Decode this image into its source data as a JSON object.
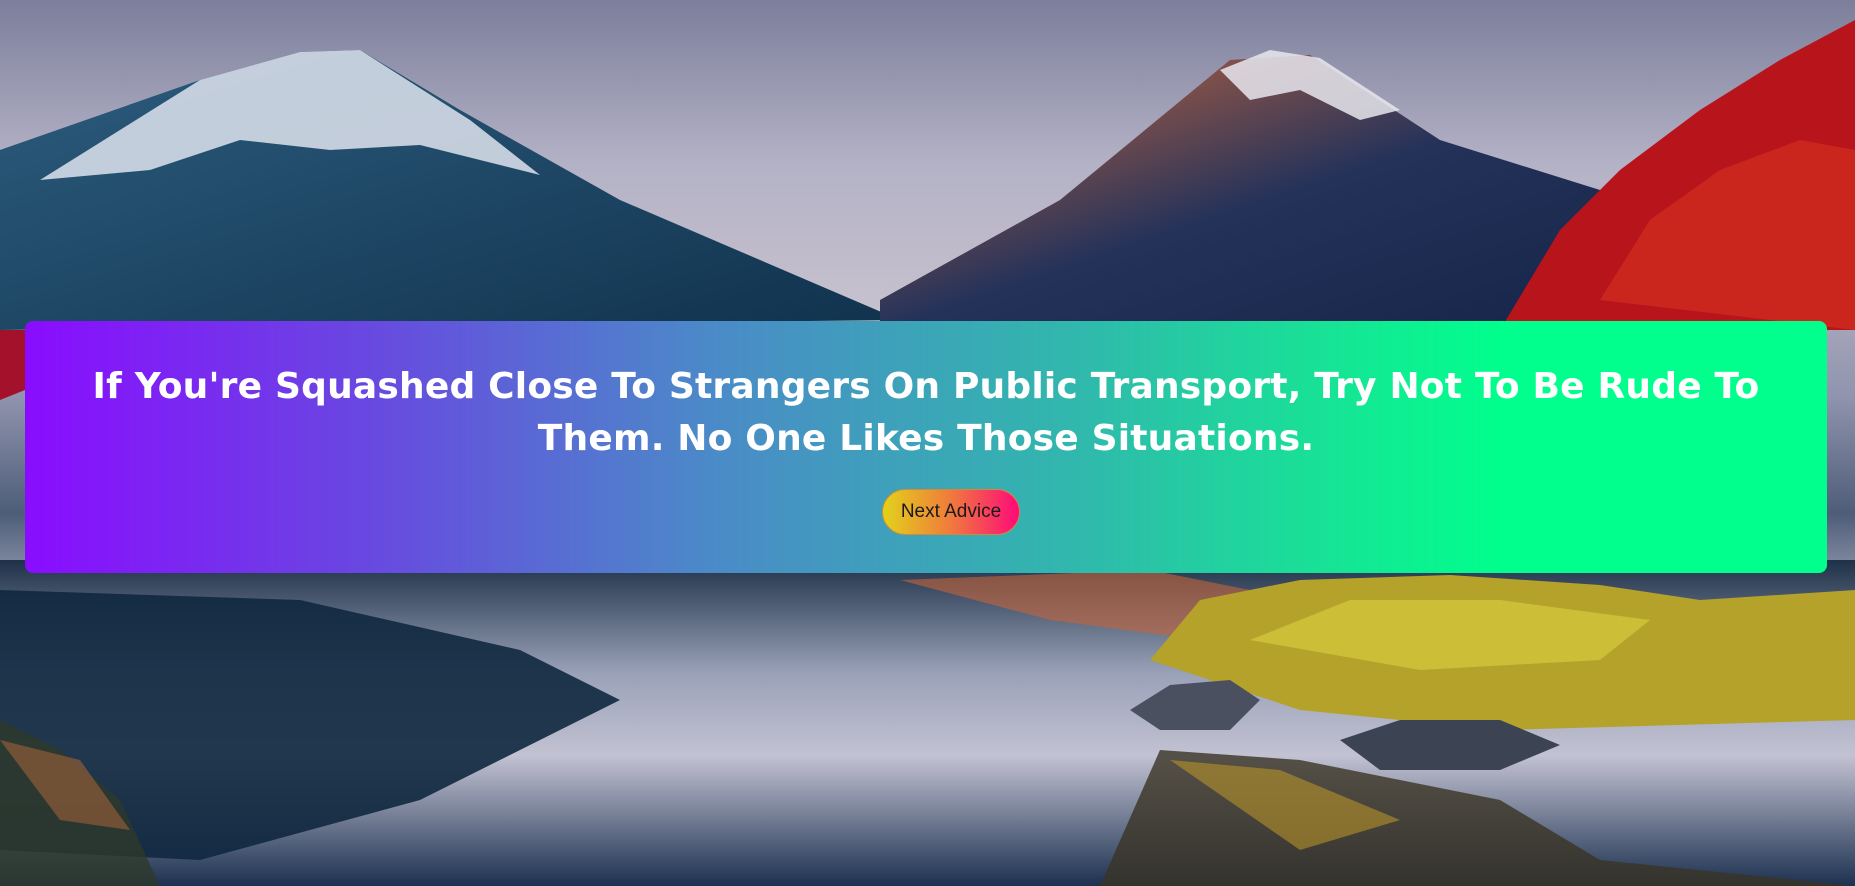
{
  "advice": {
    "text": "If You're Squashed Close To Strangers On Public Transport, Try Not To Be Rude To Them. No One Likes Those Situations."
  },
  "controls": {
    "next_button_label": "Next Advice"
  },
  "colors": {
    "card_gradient_start": "#8a0cff",
    "card_gradient_end": "#00ff8c",
    "button_gradient_start": "#e2d21a",
    "button_gradient_end": "#ff0a7a",
    "advice_text": "#ffffff"
  },
  "background": {
    "image": "mountains-lake-landscape"
  }
}
